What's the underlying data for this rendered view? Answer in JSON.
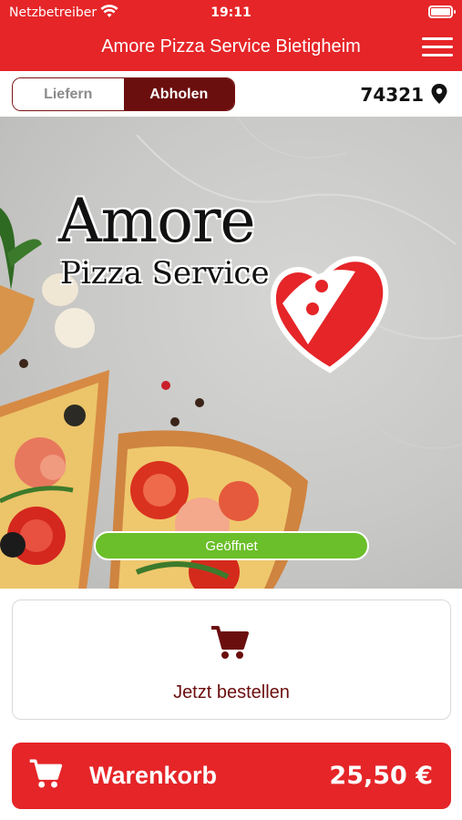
{
  "status_bar": {
    "carrier": "Netzbetreiber",
    "time": "19:11"
  },
  "nav": {
    "title": "Amore Pizza Service Bietigheim"
  },
  "mode_toggle": {
    "deliver_label": "Liefern",
    "pickup_label": "Abholen",
    "selected": "Abholen"
  },
  "location": {
    "postcode": "74321"
  },
  "hero": {
    "brand_line1": "Amore",
    "brand_line2": "Pizza Service",
    "status_label": "Geöffnet"
  },
  "order_card": {
    "label": "Jetzt bestellen"
  },
  "cart": {
    "label": "Warenkorb",
    "total": "25,50 €"
  },
  "icons": [
    "wifi-icon",
    "battery-icon",
    "menu-icon",
    "location-pin-icon",
    "heart-pizza-logo",
    "cart-icon"
  ],
  "colors": {
    "brand_red": "#e52528",
    "dark_red": "#6b0e0e",
    "open_green": "#6bbf2a"
  }
}
